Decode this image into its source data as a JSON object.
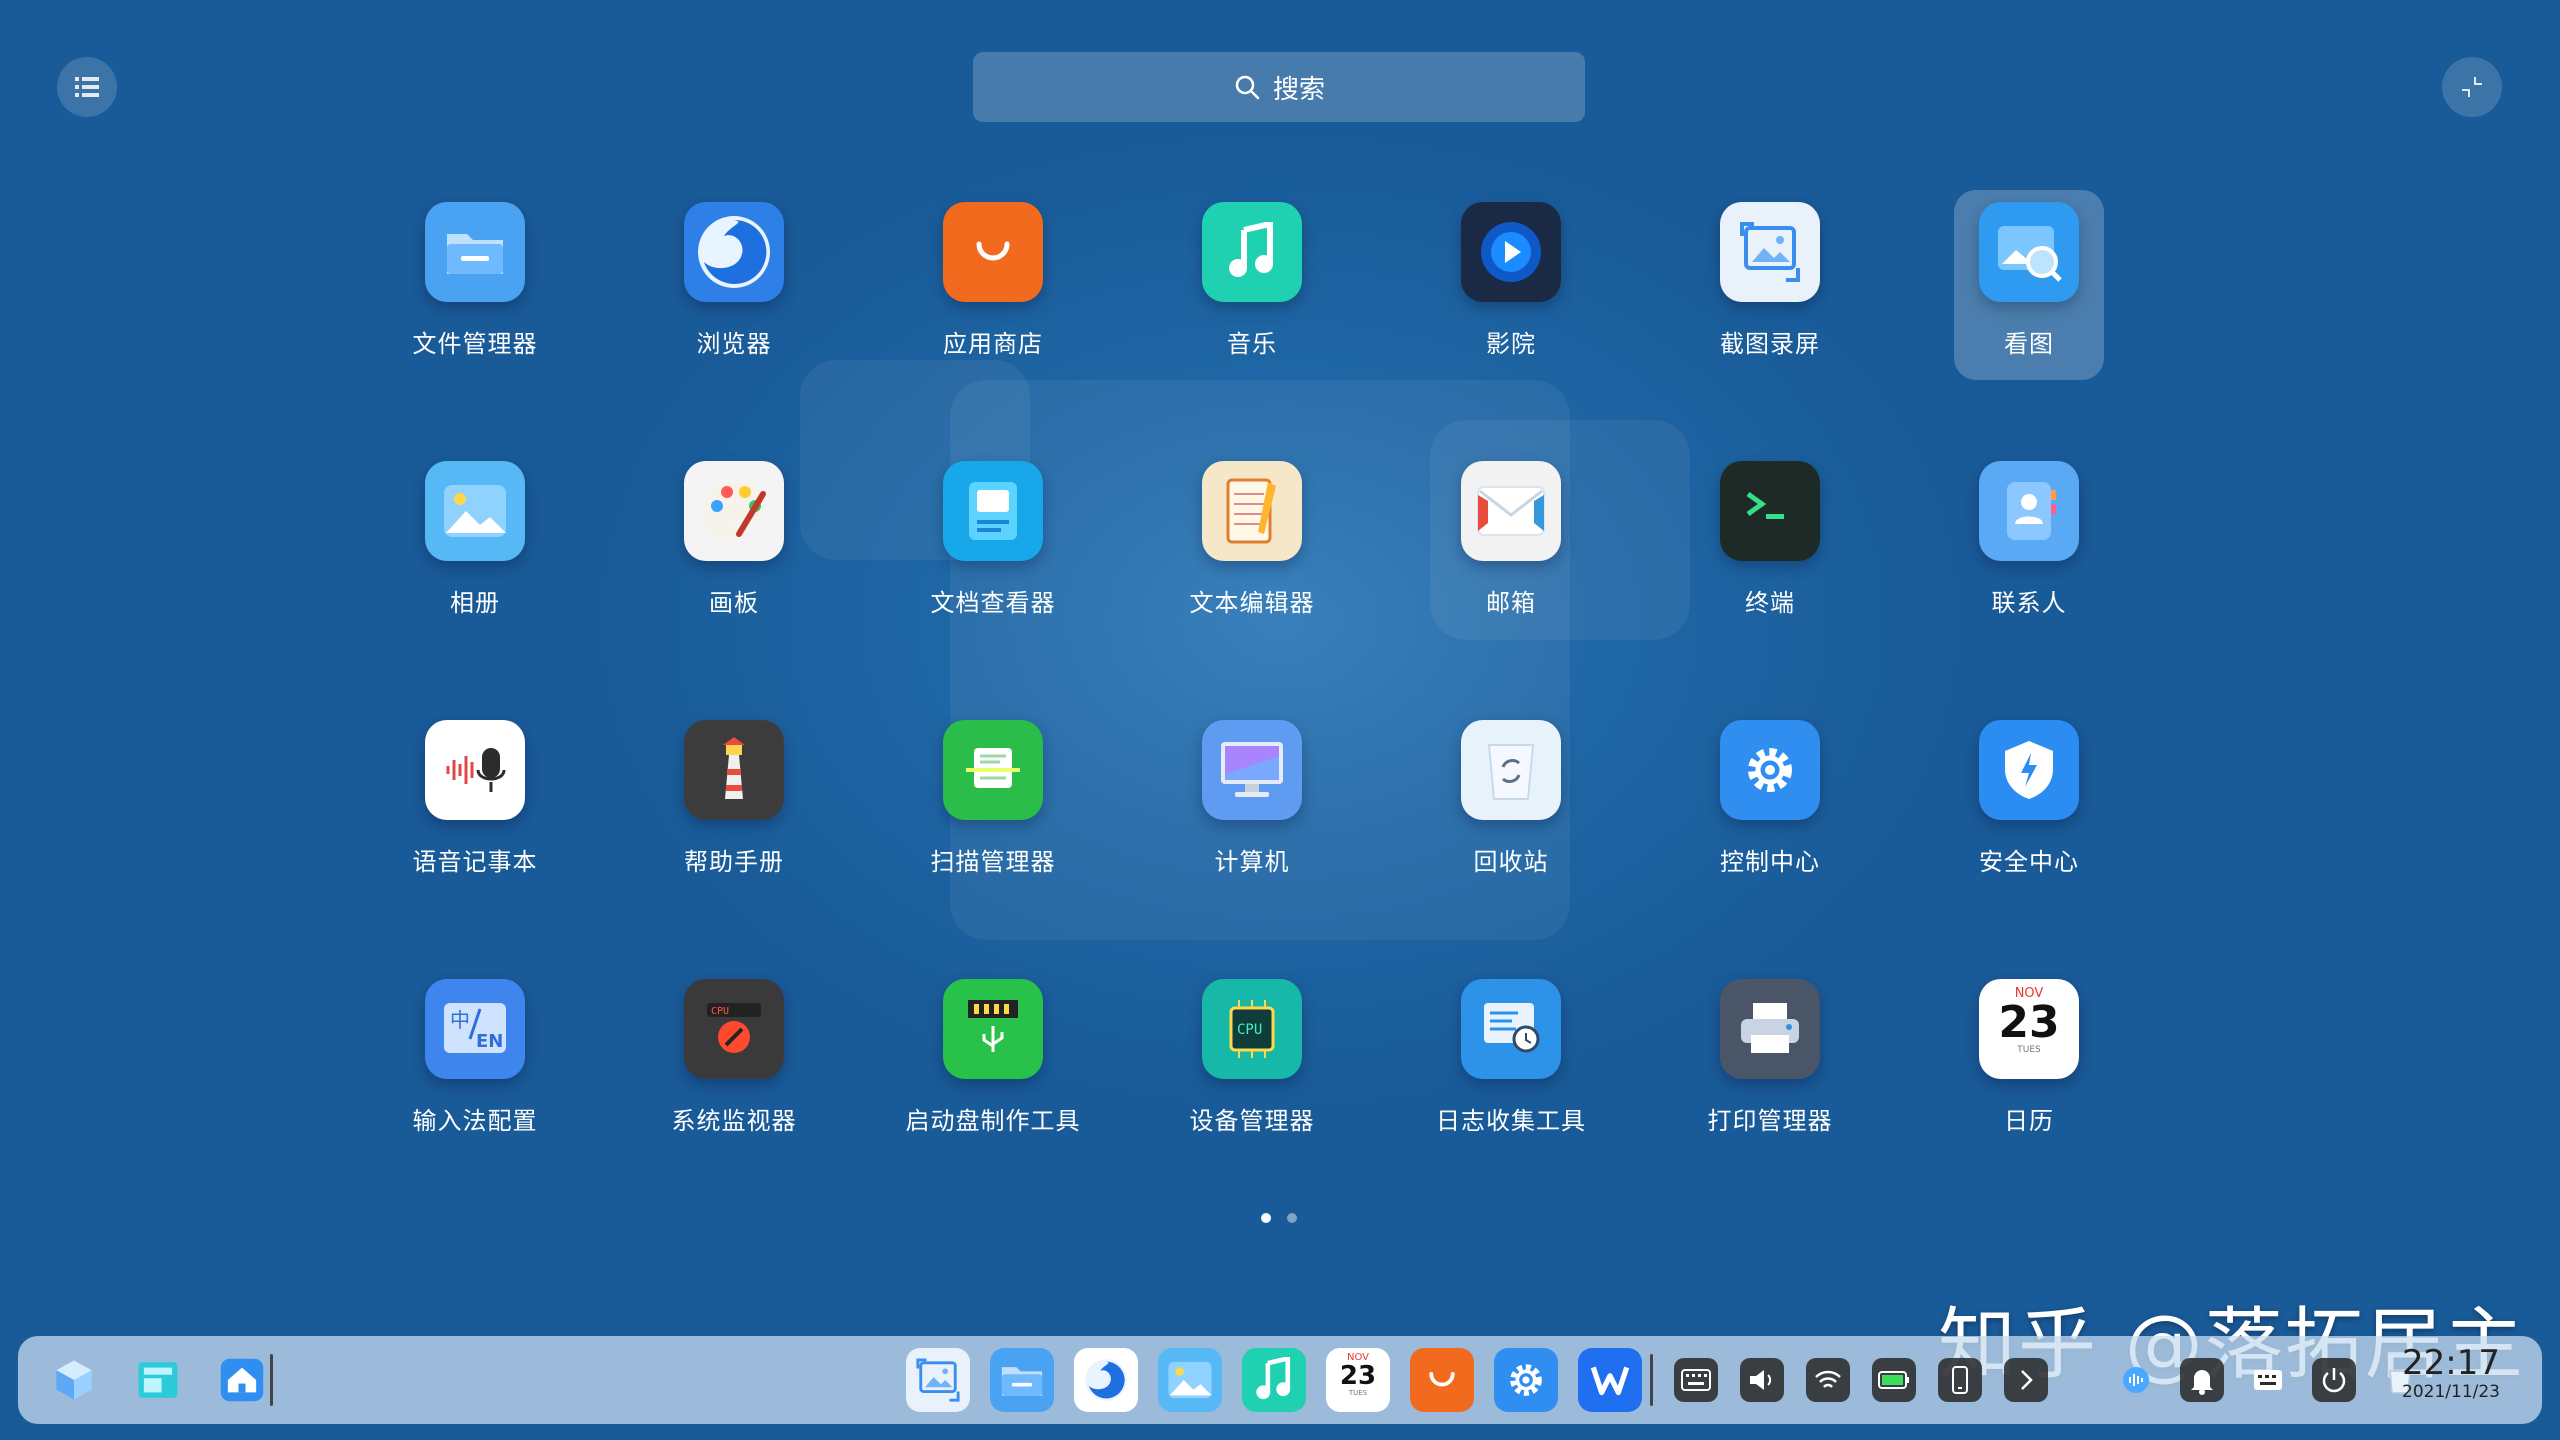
{
  "search": {
    "label": "搜索"
  },
  "apps": [
    {
      "label": "文件管理器",
      "icon": "folder-icon",
      "color": "#4aa3f2"
    },
    {
      "label": "浏览器",
      "icon": "browser-icon",
      "color": "#2e7fe8"
    },
    {
      "label": "应用商店",
      "icon": "store-bag-icon",
      "color": "#f26a1e"
    },
    {
      "label": "音乐",
      "icon": "music-note-icon",
      "color": "#1fd1b0"
    },
    {
      "label": "影院",
      "icon": "play-disc-icon",
      "color": "#1b2a44"
    },
    {
      "label": "截图录屏",
      "icon": "screenshot-icon",
      "color": "#e9f1fb"
    },
    {
      "label": "看图",
      "icon": "image-viewer-icon",
      "color": "#2f9bf0"
    },
    {
      "label": "相册",
      "icon": "album-icon",
      "color": "#56b9f6"
    },
    {
      "label": "画板",
      "icon": "palette-icon",
      "color": "#f4f4f4"
    },
    {
      "label": "文档查看器",
      "icon": "document-viewer-icon",
      "color": "#18a7e8"
    },
    {
      "label": "文本编辑器",
      "icon": "notebook-pencil-icon",
      "color": "#f6e7c8"
    },
    {
      "label": "邮箱",
      "icon": "envelope-icon",
      "color": "#f2f2f2"
    },
    {
      "label": "终端",
      "icon": "terminal-icon",
      "color": "#1d2a26"
    },
    {
      "label": "联系人",
      "icon": "contacts-icon",
      "color": "#5aa9f5"
    },
    {
      "label": "语音记事本",
      "icon": "voice-memo-icon",
      "color": "#ffffff"
    },
    {
      "label": "帮助手册",
      "icon": "lighthouse-icon",
      "color": "#3c3c3c"
    },
    {
      "label": "扫描管理器",
      "icon": "scanner-icon",
      "color": "#2bbd4a"
    },
    {
      "label": "计算机",
      "icon": "monitor-icon",
      "color": "#5f9bf0"
    },
    {
      "label": "回收站",
      "icon": "trash-icon",
      "color": "#e8f2fb"
    },
    {
      "label": "控制中心",
      "icon": "gear-icon",
      "color": "#2f8ef0"
    },
    {
      "label": "安全中心",
      "icon": "shield-icon",
      "color": "#2b8df2"
    },
    {
      "label": "输入法配置",
      "icon": "input-method-icon",
      "color": "#3e86ee"
    },
    {
      "label": "系统监视器",
      "icon": "cpu-meter-icon",
      "color": "#3a3a3a"
    },
    {
      "label": "启动盘制作工具",
      "icon": "usb-drive-icon",
      "color": "#28c24a"
    },
    {
      "label": "设备管理器",
      "icon": "cpu-chip-icon",
      "color": "#18b8a8"
    },
    {
      "label": "日志收集工具",
      "icon": "log-collector-icon",
      "color": "#2d93e8"
    },
    {
      "label": "打印管理器",
      "icon": "printer-icon",
      "color": "#4a5668"
    },
    {
      "label": "日历",
      "icon": "calendar-icon",
      "color": "#ffffff",
      "cal_month": "NOV",
      "cal_day": "23",
      "cal_weekday": "TUES"
    }
  ],
  "selected_app": "看图",
  "pages": {
    "count": 2,
    "current": 1
  },
  "dock": {
    "left": [
      "launcher-cube-icon",
      "multitask-view-icon",
      "desktop-home-icon"
    ],
    "apps": [
      "screenshot-icon",
      "folder-icon",
      "browser-icon",
      "album-icon",
      "music-note-icon",
      "calendar-icon",
      "store-bag-icon",
      "gear-icon",
      "wps-office-icon"
    ],
    "calendar_month": "NOV",
    "calendar_day": "23",
    "calendar_weekday": "TUES",
    "tray": [
      "keyboard-icon",
      "volume-icon",
      "wifi-icon",
      "battery-icon",
      "phone-icon",
      "chevron-right-icon",
      "assistant-icon",
      "bell-icon",
      "input-icon",
      "power-icon",
      "trash-icon"
    ]
  },
  "clock": {
    "time": "22:17",
    "date": "2021/11/23"
  },
  "watermark": "知乎 @落拓居主"
}
